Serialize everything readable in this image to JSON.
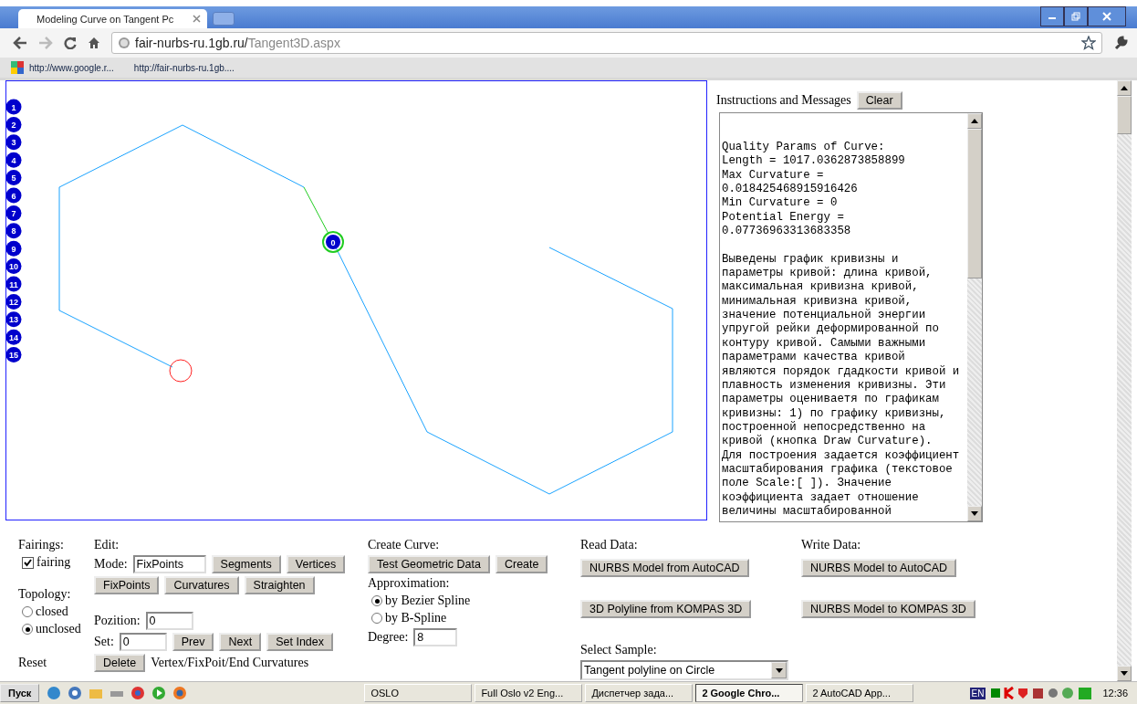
{
  "browser": {
    "tab_title": "Modeling Curve on Tangent Pc",
    "url_host": "fair-nurbs-ru.1gb.ru/",
    "url_path": "Tangent3D.aspx",
    "bookmarks": [
      "http://www.google.r...",
      "http://fair-nurbs-ru.1gb...."
    ]
  },
  "canvas": {
    "point_labels": [
      "1",
      "2",
      "3",
      "4",
      "5",
      "6",
      "7",
      "8",
      "9",
      "10",
      "11",
      "12",
      "13",
      "14",
      "15"
    ],
    "current_point": "0"
  },
  "messages": {
    "title": "Instructions and Messages",
    "clear_button": "Clear",
    "quality_lines": [
      "Quality Params of Curve:",
      "Length = 1017.0362873858899",
      "Max Curvature =",
      "0.018425468915916426",
      "Min Curvature = 0",
      "Potential Energy =",
      "0.07736963313683358"
    ],
    "paragraph_lines": [
      "Выведены график кривизны и",
      "параметры кривой: длина кривой,",
      "максимальная кривизна кривой,",
      "минимальная кривизна кривой,",
      "значение потенциальной энергии",
      "упругой рейки деформированной по",
      "контуру кривой. Самыми важными",
      "параметрами качества кривой",
      "являются порядок гдадкости кривой и",
      "плавность изменения кривизны. Эти",
      "параметры оцениваетя по графикам",
      "кривизны: 1) по графику кривизны,",
      "построенной непосредственно на",
      "кривой (кнопка Draw Curvature).",
      "Для построения задается коэффициент",
      "масштабирования графика (текстовое",
      "поле Scale:[  ]). Значение",
      "коэффициента задает отношение",
      "величины масштабированной"
    ]
  },
  "fairings": {
    "label": "Fairings:",
    "option": {
      "label": "fairing",
      "checked": true
    }
  },
  "topology": {
    "label": "Topology:",
    "options": [
      {
        "label": "closed",
        "selected": false
      },
      {
        "label": "unclosed",
        "selected": true
      }
    ]
  },
  "reset_label": "Reset",
  "edit": {
    "label": "Edit:",
    "mode_label": "Mode:",
    "mode_value": "FixPoints",
    "row1_buttons": [
      "Segments",
      "Vertices"
    ],
    "row2_buttons": [
      "FixPoints",
      "Curvatures",
      "Straighten"
    ],
    "position_label": "Pozition:",
    "position_value": "0",
    "set_label": "Set:",
    "set_value": "0",
    "set_buttons": [
      "Prev",
      "Next",
      "Set Index"
    ],
    "delete_button": "Delete",
    "delete_note": "Vertex/FixPoit/End Curvatures"
  },
  "create_curve": {
    "label": "Create Curve:",
    "buttons": [
      "Test Geometric Data",
      "Create"
    ],
    "approximation_label": "Approximation:",
    "options": [
      {
        "label": "by Bezier Spline",
        "selected": true
      },
      {
        "label": "by B-Spline",
        "selected": false
      }
    ],
    "degree_label": "Degree:",
    "degree_value": "8"
  },
  "read_data": {
    "label": "Read Data:",
    "buttons": [
      "NURBS Model from AutoCAD",
      "3D Polyline from KOMPAS 3D"
    ],
    "sample_label": "Select Sample:",
    "sample_value": "Tangent polyline on Circle"
  },
  "write_data": {
    "label": "Write Data:",
    "buttons": [
      "NURBS Model to AutoCAD",
      "NURBS Model to KOMPAS 3D"
    ]
  },
  "taskbar": {
    "start": "Пуск",
    "tasks": [
      {
        "label": "OSLO",
        "selected": false
      },
      {
        "label": "Full  Oslo v2  Eng...",
        "selected": false
      },
      {
        "label": "Диспетчер зада...",
        "selected": false
      },
      {
        "label": "2 Google Chro...",
        "selected": true
      },
      {
        "label": "2 AutoCAD App...",
        "selected": false
      }
    ],
    "lang": "EN",
    "clock": "12:36"
  }
}
